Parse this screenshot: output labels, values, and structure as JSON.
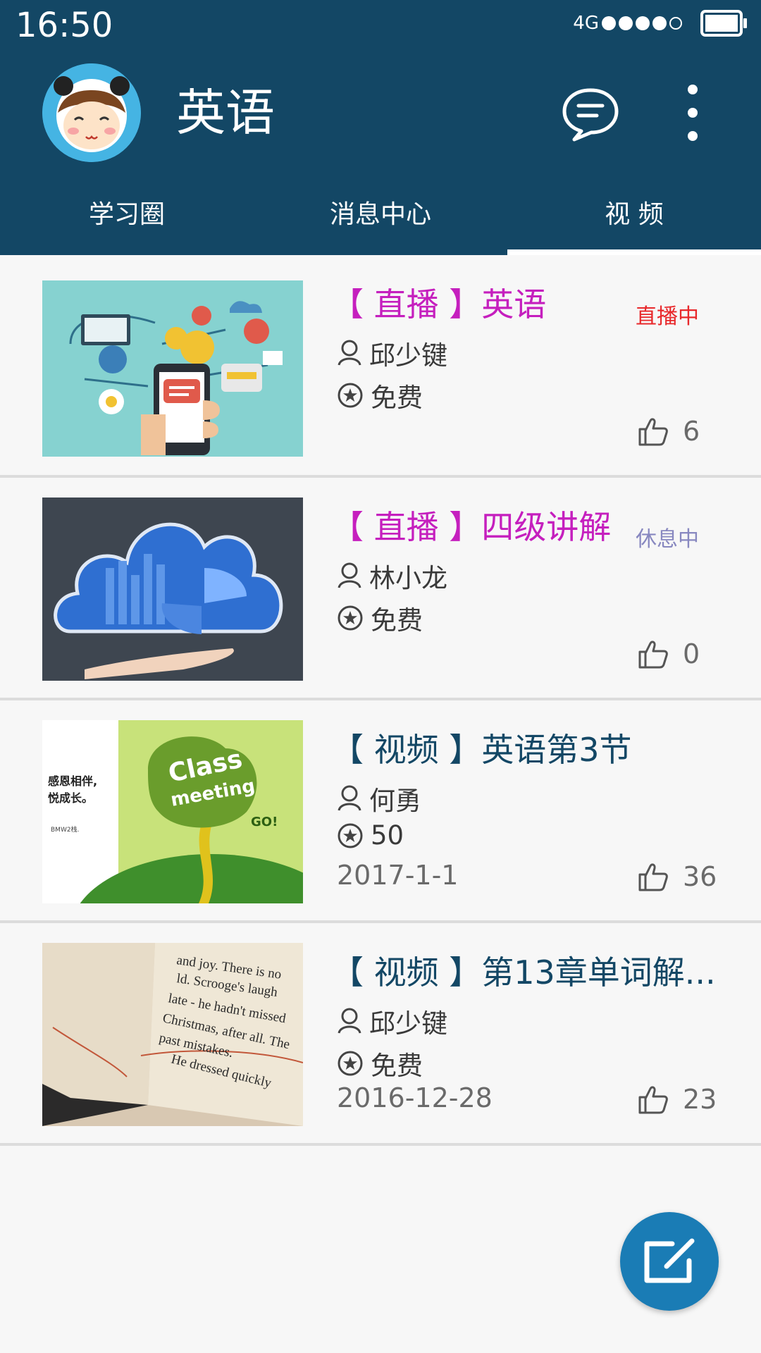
{
  "status_bar": {
    "time": "16:50",
    "network": "4G"
  },
  "header": {
    "title": "英语"
  },
  "tabs": [
    {
      "label": "学习圈"
    },
    {
      "label": "消息中心"
    },
    {
      "label": "视 频",
      "active": true
    }
  ],
  "items": [
    {
      "title": "【 直播 】英语",
      "kind": "live",
      "status": "直播中",
      "status_color": "#e8282b",
      "author": "邱少键",
      "price": "免费",
      "date": "",
      "likes": "6"
    },
    {
      "title": "【 直播 】四级讲解",
      "kind": "live",
      "status": "休息中",
      "status_color": "#8888c0",
      "author": "林小龙",
      "price": "免费",
      "date": "",
      "likes": "0"
    },
    {
      "title": "【 视频 】英语第3节",
      "kind": "video",
      "status": "",
      "author": "何勇",
      "price": "50",
      "date": "2017-1-1",
      "likes": "36"
    },
    {
      "title": "【 视频 】第13章单词解...",
      "kind": "video",
      "status": "",
      "author": "邱少键",
      "price": "免费",
      "date": "2016-12-28",
      "likes": "23"
    }
  ],
  "thumbs": {
    "class_meeting": {
      "side_line1": "感恩相伴,",
      "side_line2": "悦成长。",
      "side_small": "BMW2栈.",
      "word1": "Class",
      "word2": "meeting",
      "go": "GO!"
    },
    "book": {
      "lines": [
        "and joy. There is no",
        "ld. Scrooge's laugh",
        "late - he hadn't missed",
        "Christmas, after all. The",
        "past mistakes.",
        "He dressed quickly"
      ]
    }
  },
  "colors": {
    "header_bg": "#134765",
    "live_title": "#c51fbe",
    "video_title": "#134765",
    "fab": "#1a7cb5"
  },
  "icons": {
    "chat": "chat-bubble-icon",
    "more": "more-vert-icon",
    "person": "person-icon",
    "star": "star-circle-icon",
    "thumb": "thumb-up-icon",
    "fab": "edit-icon"
  }
}
